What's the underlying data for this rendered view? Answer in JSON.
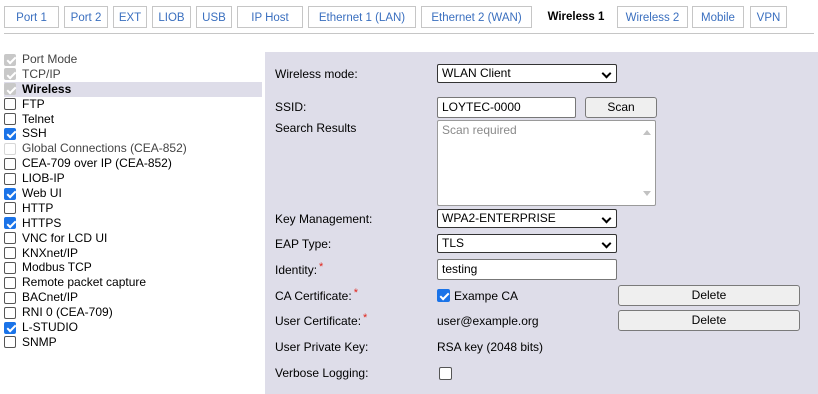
{
  "tabs": [
    {
      "label": "Port 1"
    },
    {
      "label": "Port 2"
    },
    {
      "label": "EXT"
    },
    {
      "label": "LIOB"
    },
    {
      "label": "USB"
    },
    {
      "label": "IP Host"
    },
    {
      "label": "Ethernet 1 (LAN)"
    },
    {
      "label": "Ethernet 2 (WAN)"
    },
    {
      "label": "Wireless 1",
      "active": true
    },
    {
      "label": "Wireless 2"
    },
    {
      "label": "Mobile"
    },
    {
      "label": "VPN"
    }
  ],
  "sidebar": {
    "items": [
      {
        "label": "Port Mode",
        "checked": true,
        "disabled": true
      },
      {
        "label": "TCP/IP",
        "checked": true,
        "disabled": true
      },
      {
        "label": "Wireless",
        "checked": true,
        "disabled": true,
        "selected": true
      },
      {
        "label": "FTP",
        "checked": false
      },
      {
        "label": "Telnet",
        "checked": false
      },
      {
        "label": "SSH",
        "checked": true
      },
      {
        "label": "Global Connections (CEA-852)",
        "checked": false,
        "disabled": true
      },
      {
        "label": "CEA-709 over IP (CEA-852)",
        "checked": false
      },
      {
        "label": "LIOB-IP",
        "checked": false
      },
      {
        "label": "Web UI",
        "checked": true
      },
      {
        "label": "HTTP",
        "checked": false
      },
      {
        "label": "HTTPS",
        "checked": true
      },
      {
        "label": "VNC for LCD UI",
        "checked": false
      },
      {
        "label": "KNXnet/IP",
        "checked": false
      },
      {
        "label": "Modbus TCP",
        "checked": false
      },
      {
        "label": "Remote packet capture",
        "checked": false
      },
      {
        "label": "BACnet/IP",
        "checked": false
      },
      {
        "label": "RNI 0 (CEA-709)",
        "checked": false
      },
      {
        "label": "L-STUDIO",
        "checked": true
      },
      {
        "label": "SNMP",
        "checked": false
      }
    ]
  },
  "form": {
    "wireless_mode": {
      "label": "Wireless mode:",
      "value": "WLAN Client"
    },
    "ssid": {
      "label": "SSID:",
      "value": "LOYTEC-0000",
      "scan_label": "Scan"
    },
    "search_results": {
      "label": "Search Results",
      "placeholder": "Scan required"
    },
    "key_management": {
      "label": "Key Management:",
      "value": "WPA2-ENTERPRISE"
    },
    "eap_type": {
      "label": "EAP Type:",
      "value": "TLS"
    },
    "identity": {
      "label": "Identity:",
      "required_mark": "*",
      "value": "testing"
    },
    "ca_certificate": {
      "label": "CA Certificate:",
      "required_mark": "*",
      "checked": true,
      "value": "Exampe CA",
      "delete_label": "Delete"
    },
    "user_certificate": {
      "label": "User Certificate:",
      "required_mark": "*",
      "value": "user@example.org",
      "delete_label": "Delete"
    },
    "user_private_key": {
      "label": "User Private Key:",
      "value": "RSA key (2048 bits)"
    },
    "verbose_logging": {
      "label": "Verbose Logging:",
      "checked": false
    }
  },
  "colors": {
    "accent": "#1a73e8",
    "panel_bg": "#dedde9",
    "tab_link": "#3a6fbf",
    "required": "#e0241b"
  }
}
